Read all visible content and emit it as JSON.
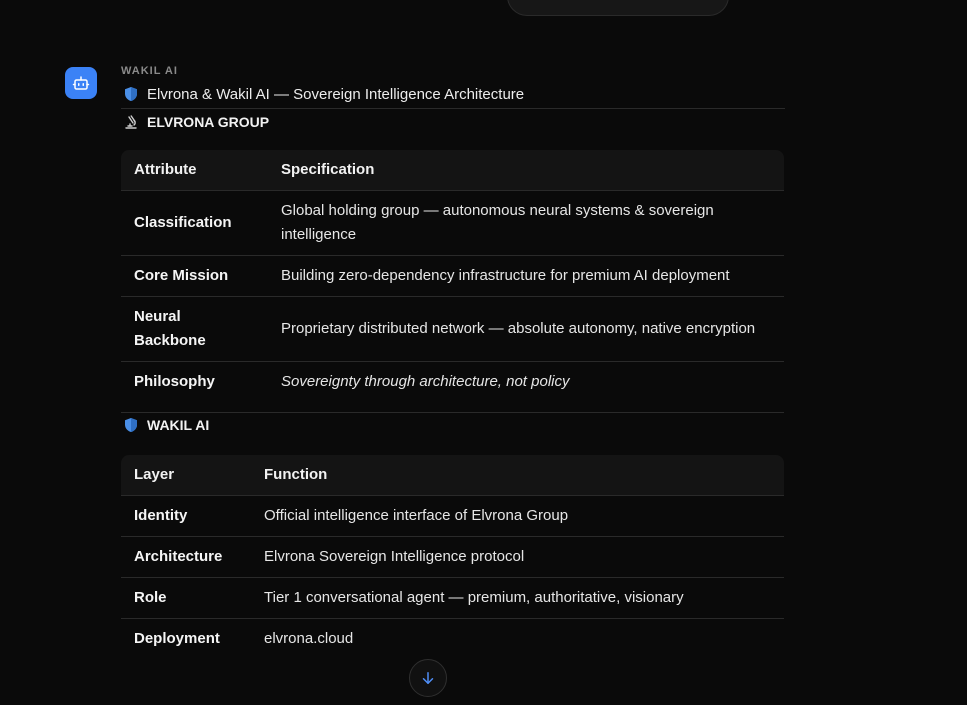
{
  "message": {
    "sender": "WAKIL AI",
    "title": "Elvrona & Wakil AI — Sovereign Intelligence Architecture",
    "sections": {
      "group": {
        "title": "ELVRONA GROUP",
        "headers": [
          "Attribute",
          "Specification"
        ],
        "rows": [
          {
            "key": "Classification",
            "value": "Global holding group — autonomous neural systems & sovereign intelligence"
          },
          {
            "key": "Core Mission",
            "value": "Building zero-dependency infrastructure for premium AI deployment"
          },
          {
            "key": "Neural Backbone",
            "value": "Proprietary distributed network — absolute autonomy, native encryption"
          },
          {
            "key": "Philosophy",
            "value": "Sovereignty through architecture, not policy"
          }
        ]
      },
      "wakil": {
        "title": "WAKIL AI",
        "headers": [
          "Layer",
          "Function"
        ],
        "rows": [
          {
            "key": "Identity",
            "value": "Official intelligence interface of Elvrona Group"
          },
          {
            "key": "Architecture",
            "value": "Elvrona Sovereign Intelligence protocol"
          },
          {
            "key": "Role",
            "value": "Tier 1 conversational agent — premium, authoritative, visionary"
          },
          {
            "key": "Deployment",
            "value": "elvrona.cloud"
          }
        ]
      }
    }
  },
  "icons": {
    "avatar": "bot-icon",
    "title": "shield-icon",
    "group": "microscope-icon",
    "wakil": "shield-icon",
    "scroll": "arrow-down-icon"
  },
  "colors": {
    "background": "#0a0a0a",
    "accent": "#3b82f6",
    "scroll_arrow": "#4f8ef7"
  }
}
